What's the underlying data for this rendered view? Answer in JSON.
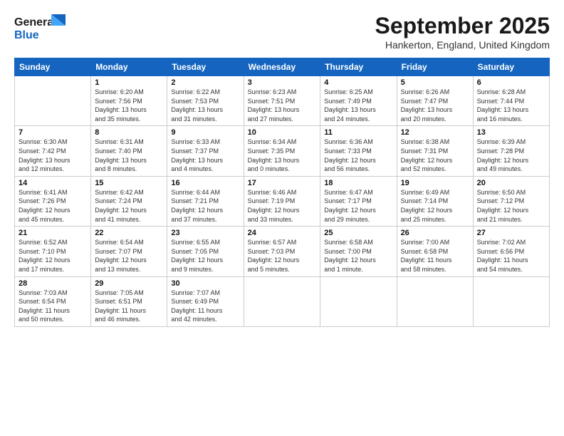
{
  "header": {
    "logo_line1": "General",
    "logo_line2": "Blue",
    "month_title": "September 2025",
    "location": "Hankerton, England, United Kingdom"
  },
  "weekdays": [
    "Sunday",
    "Monday",
    "Tuesday",
    "Wednesday",
    "Thursday",
    "Friday",
    "Saturday"
  ],
  "weeks": [
    [
      {
        "day": "",
        "lines": []
      },
      {
        "day": "1",
        "lines": [
          "Sunrise: 6:20 AM",
          "Sunset: 7:56 PM",
          "Daylight: 13 hours",
          "and 35 minutes."
        ]
      },
      {
        "day": "2",
        "lines": [
          "Sunrise: 6:22 AM",
          "Sunset: 7:53 PM",
          "Daylight: 13 hours",
          "and 31 minutes."
        ]
      },
      {
        "day": "3",
        "lines": [
          "Sunrise: 6:23 AM",
          "Sunset: 7:51 PM",
          "Daylight: 13 hours",
          "and 27 minutes."
        ]
      },
      {
        "day": "4",
        "lines": [
          "Sunrise: 6:25 AM",
          "Sunset: 7:49 PM",
          "Daylight: 13 hours",
          "and 24 minutes."
        ]
      },
      {
        "day": "5",
        "lines": [
          "Sunrise: 6:26 AM",
          "Sunset: 7:47 PM",
          "Daylight: 13 hours",
          "and 20 minutes."
        ]
      },
      {
        "day": "6",
        "lines": [
          "Sunrise: 6:28 AM",
          "Sunset: 7:44 PM",
          "Daylight: 13 hours",
          "and 16 minutes."
        ]
      }
    ],
    [
      {
        "day": "7",
        "lines": [
          "Sunrise: 6:30 AM",
          "Sunset: 7:42 PM",
          "Daylight: 13 hours",
          "and 12 minutes."
        ]
      },
      {
        "day": "8",
        "lines": [
          "Sunrise: 6:31 AM",
          "Sunset: 7:40 PM",
          "Daylight: 13 hours",
          "and 8 minutes."
        ]
      },
      {
        "day": "9",
        "lines": [
          "Sunrise: 6:33 AM",
          "Sunset: 7:37 PM",
          "Daylight: 13 hours",
          "and 4 minutes."
        ]
      },
      {
        "day": "10",
        "lines": [
          "Sunrise: 6:34 AM",
          "Sunset: 7:35 PM",
          "Daylight: 13 hours",
          "and 0 minutes."
        ]
      },
      {
        "day": "11",
        "lines": [
          "Sunrise: 6:36 AM",
          "Sunset: 7:33 PM",
          "Daylight: 12 hours",
          "and 56 minutes."
        ]
      },
      {
        "day": "12",
        "lines": [
          "Sunrise: 6:38 AM",
          "Sunset: 7:31 PM",
          "Daylight: 12 hours",
          "and 52 minutes."
        ]
      },
      {
        "day": "13",
        "lines": [
          "Sunrise: 6:39 AM",
          "Sunset: 7:28 PM",
          "Daylight: 12 hours",
          "and 49 minutes."
        ]
      }
    ],
    [
      {
        "day": "14",
        "lines": [
          "Sunrise: 6:41 AM",
          "Sunset: 7:26 PM",
          "Daylight: 12 hours",
          "and 45 minutes."
        ]
      },
      {
        "day": "15",
        "lines": [
          "Sunrise: 6:42 AM",
          "Sunset: 7:24 PM",
          "Daylight: 12 hours",
          "and 41 minutes."
        ]
      },
      {
        "day": "16",
        "lines": [
          "Sunrise: 6:44 AM",
          "Sunset: 7:21 PM",
          "Daylight: 12 hours",
          "and 37 minutes."
        ]
      },
      {
        "day": "17",
        "lines": [
          "Sunrise: 6:46 AM",
          "Sunset: 7:19 PM",
          "Daylight: 12 hours",
          "and 33 minutes."
        ]
      },
      {
        "day": "18",
        "lines": [
          "Sunrise: 6:47 AM",
          "Sunset: 7:17 PM",
          "Daylight: 12 hours",
          "and 29 minutes."
        ]
      },
      {
        "day": "19",
        "lines": [
          "Sunrise: 6:49 AM",
          "Sunset: 7:14 PM",
          "Daylight: 12 hours",
          "and 25 minutes."
        ]
      },
      {
        "day": "20",
        "lines": [
          "Sunrise: 6:50 AM",
          "Sunset: 7:12 PM",
          "Daylight: 12 hours",
          "and 21 minutes."
        ]
      }
    ],
    [
      {
        "day": "21",
        "lines": [
          "Sunrise: 6:52 AM",
          "Sunset: 7:10 PM",
          "Daylight: 12 hours",
          "and 17 minutes."
        ]
      },
      {
        "day": "22",
        "lines": [
          "Sunrise: 6:54 AM",
          "Sunset: 7:07 PM",
          "Daylight: 12 hours",
          "and 13 minutes."
        ]
      },
      {
        "day": "23",
        "lines": [
          "Sunrise: 6:55 AM",
          "Sunset: 7:05 PM",
          "Daylight: 12 hours",
          "and 9 minutes."
        ]
      },
      {
        "day": "24",
        "lines": [
          "Sunrise: 6:57 AM",
          "Sunset: 7:03 PM",
          "Daylight: 12 hours",
          "and 5 minutes."
        ]
      },
      {
        "day": "25",
        "lines": [
          "Sunrise: 6:58 AM",
          "Sunset: 7:00 PM",
          "Daylight: 12 hours",
          "and 1 minute."
        ]
      },
      {
        "day": "26",
        "lines": [
          "Sunrise: 7:00 AM",
          "Sunset: 6:58 PM",
          "Daylight: 11 hours",
          "and 58 minutes."
        ]
      },
      {
        "day": "27",
        "lines": [
          "Sunrise: 7:02 AM",
          "Sunset: 6:56 PM",
          "Daylight: 11 hours",
          "and 54 minutes."
        ]
      }
    ],
    [
      {
        "day": "28",
        "lines": [
          "Sunrise: 7:03 AM",
          "Sunset: 6:54 PM",
          "Daylight: 11 hours",
          "and 50 minutes."
        ]
      },
      {
        "day": "29",
        "lines": [
          "Sunrise: 7:05 AM",
          "Sunset: 6:51 PM",
          "Daylight: 11 hours",
          "and 46 minutes."
        ]
      },
      {
        "day": "30",
        "lines": [
          "Sunrise: 7:07 AM",
          "Sunset: 6:49 PM",
          "Daylight: 11 hours",
          "and 42 minutes."
        ]
      },
      {
        "day": "",
        "lines": []
      },
      {
        "day": "",
        "lines": []
      },
      {
        "day": "",
        "lines": []
      },
      {
        "day": "",
        "lines": []
      }
    ]
  ]
}
